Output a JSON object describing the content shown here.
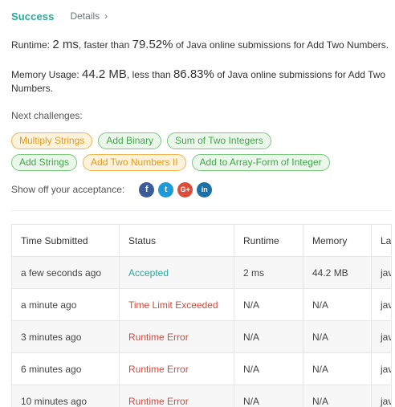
{
  "header": {
    "status": "Success",
    "details_label": "Details",
    "details_chevron": "›"
  },
  "runtime": {
    "label": "Runtime:",
    "value": "2 ms",
    "mid": ", faster than",
    "percent": "79.52%",
    "tail": "of Java online submissions for Add Two Numbers."
  },
  "memory": {
    "label": "Memory Usage:",
    "value": "44.2 MB",
    "mid": ", less than",
    "percent": "86.83%",
    "tail": "of Java online submissions for Add Two",
    "tail2": "Numbers."
  },
  "next": {
    "label": "Next challenges:",
    "row1": [
      {
        "label": "Multiply Strings",
        "difficulty": "medium"
      },
      {
        "label": "Add Binary",
        "difficulty": "easy"
      },
      {
        "label": "Sum of Two Integers",
        "difficulty": "easy"
      }
    ],
    "row2": [
      {
        "label": "Add Strings",
        "difficulty": "easy"
      },
      {
        "label": "Add Two Numbers II",
        "difficulty": "medium"
      },
      {
        "label": "Add to Array-Form of Integer",
        "difficulty": "easy"
      }
    ]
  },
  "share": {
    "label": "Show off your acceptance:",
    "icons": [
      {
        "name": "facebook-icon",
        "glyph": "f"
      },
      {
        "name": "twitter-icon",
        "glyph": "t"
      },
      {
        "name": "google-plus-icon",
        "glyph": "G+"
      },
      {
        "name": "linkedin-icon",
        "glyph": "in"
      }
    ]
  },
  "table": {
    "headers": [
      "Time Submitted",
      "Status",
      "Runtime",
      "Memory",
      "Language"
    ],
    "rows": [
      {
        "time": "a few seconds ago",
        "status": "Accepted",
        "status_type": "accepted",
        "runtime": "2 ms",
        "memory": "44.2 MB",
        "language": "java"
      },
      {
        "time": "a minute ago",
        "status": "Time Limit Exceeded",
        "status_type": "error",
        "runtime": "N/A",
        "memory": "N/A",
        "language": "java"
      },
      {
        "time": "3 minutes ago",
        "status": "Runtime Error",
        "status_type": "error",
        "runtime": "N/A",
        "memory": "N/A",
        "language": "java"
      },
      {
        "time": "6 minutes ago",
        "status": "Runtime Error",
        "status_type": "error",
        "runtime": "N/A",
        "memory": "N/A",
        "language": "java"
      },
      {
        "time": "10 minutes ago",
        "status": "Runtime Error",
        "status_type": "error",
        "runtime": "N/A",
        "memory": "N/A",
        "language": "java"
      }
    ]
  },
  "colors": {
    "success": "#2aa89a",
    "error": "#d14a3c",
    "medium_tag": "#e59b1c",
    "easy_tag": "#3fa847"
  }
}
